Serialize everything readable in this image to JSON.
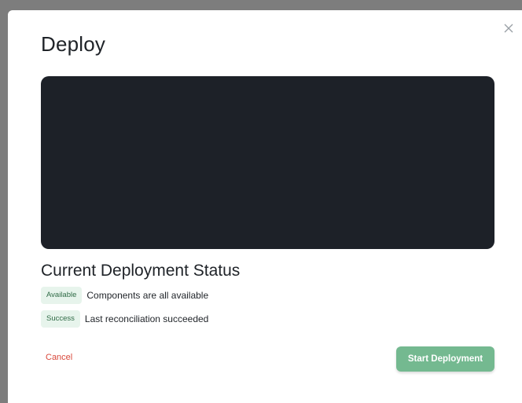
{
  "modal": {
    "title": "Deploy",
    "close_icon": "close-icon"
  },
  "terminal": {
    "background": "#1d2128"
  },
  "status": {
    "heading": "Current Deployment Status",
    "rows": [
      {
        "badge": "Available",
        "text": "Components are all available"
      },
      {
        "badge": "Success",
        "text": "Last reconciliation succeeded"
      }
    ],
    "badge_background": "#e7f4ec",
    "badge_color": "#2f6b46"
  },
  "actions": {
    "cancel_label": "Cancel",
    "start_label": "Start Deployment",
    "cancel_color": "#d9483b",
    "start_color": "#74b990"
  }
}
